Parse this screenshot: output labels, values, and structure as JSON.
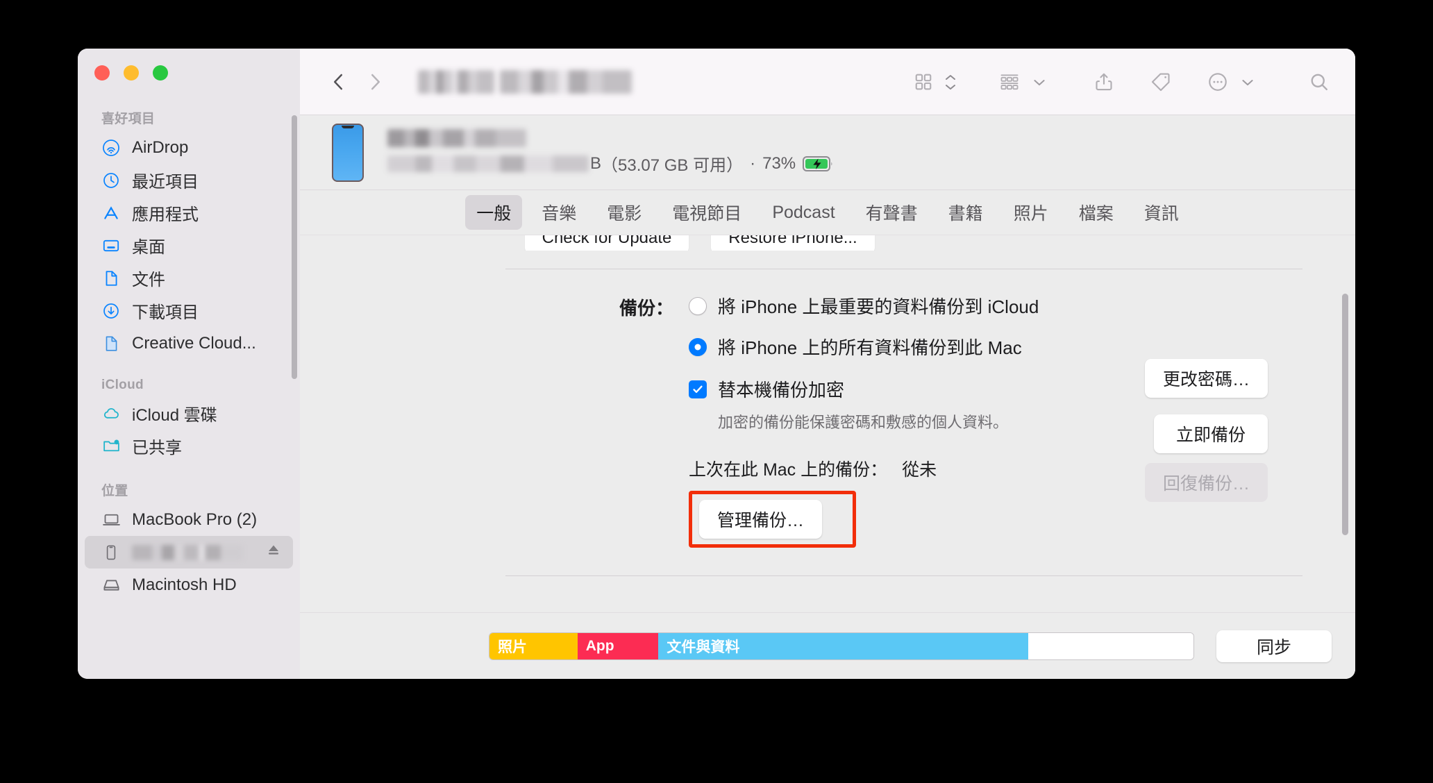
{
  "window": {
    "traffic_lights": [
      "close",
      "minimize",
      "zoom"
    ],
    "title_redacted": true
  },
  "toolbar": {
    "back_label": "‹",
    "forward_label": "›",
    "icons": [
      "grid-view-icon",
      "view-sort-chevrons-icon",
      "group-by-icon",
      "chevron-down-icon",
      "share-icon",
      "tag-icon",
      "more-actions-icon",
      "search-icon"
    ]
  },
  "sidebar": {
    "groups": [
      {
        "title": "喜好項目",
        "items": [
          {
            "label": "AirDrop",
            "icon": "airdrop-icon",
            "selected": false
          },
          {
            "label": "最近項目",
            "icon": "clock-icon",
            "selected": false
          },
          {
            "label": "應用程式",
            "icon": "applications-icon",
            "selected": false
          },
          {
            "label": "桌面",
            "icon": "desktop-icon",
            "selected": false
          },
          {
            "label": "文件",
            "icon": "document-icon",
            "selected": false
          },
          {
            "label": "下載項目",
            "icon": "downloads-icon",
            "selected": false
          },
          {
            "label": "Creative Cloud...",
            "icon": "file-blue-icon",
            "selected": false
          }
        ]
      },
      {
        "title": "iCloud",
        "items": [
          {
            "label": "iCloud 雲碟",
            "icon": "cloud-icon",
            "selected": false
          },
          {
            "label": "已共享",
            "icon": "shared-folder-icon",
            "selected": false
          }
        ]
      },
      {
        "title": "位置",
        "items": [
          {
            "label": "MacBook Pro (2)",
            "icon": "laptop-icon",
            "selected": false
          },
          {
            "label": "",
            "icon": "iphone-icon",
            "selected": true,
            "redacted": true,
            "eject": true
          },
          {
            "label": "Macintosh HD",
            "icon": "harddisk-icon",
            "selected": false
          }
        ]
      }
    ]
  },
  "device": {
    "name_redacted": true,
    "storage_free": "（53.07 GB 可用）",
    "storage_capacity_suffix": "B",
    "separator": "·",
    "battery_percent": "73%",
    "battery_charging": true
  },
  "tabs": [
    {
      "label": "一般",
      "active": true
    },
    {
      "label": "音樂",
      "active": false
    },
    {
      "label": "電影",
      "active": false
    },
    {
      "label": "電視節目",
      "active": false
    },
    {
      "label": "Podcast",
      "active": false
    },
    {
      "label": "有聲書",
      "active": false
    },
    {
      "label": "書籍",
      "active": false
    },
    {
      "label": "照片",
      "active": false
    },
    {
      "label": "檔案",
      "active": false
    },
    {
      "label": "資訊",
      "active": false
    }
  ],
  "content": {
    "clipped_buttons": [
      {
        "label": "Check for Update"
      },
      {
        "label": "Restore iPhone..."
      }
    ],
    "backup_section": {
      "label": "備份：",
      "options": [
        {
          "label": "將 iPhone 上最重要的資料備份到 iCloud",
          "checked": false
        },
        {
          "label": "將 iPhone 上的所有資料備份到此 Mac",
          "checked": true
        }
      ],
      "encrypt_checkbox": {
        "label": "替本機備份加密",
        "checked": true
      },
      "encrypt_hint": "加密的備份能保護密碼和敷感的個人資料。",
      "last_backup_label": "上次在此 Mac 上的備份：",
      "last_backup_value": "從未",
      "manage_backups_button": "管理備份…",
      "manage_backups_highlighted": true,
      "change_password_button": "更改密碼…",
      "backup_now_button": "立即備份",
      "restore_backup_button": "回復備份…",
      "restore_backup_disabled": true
    }
  },
  "bottom": {
    "capacity_segments": [
      {
        "label": "照片",
        "color": "#ffc500",
        "percent": 12.5
      },
      {
        "label": "App",
        "color": "#fc2c53",
        "percent": 11.5
      },
      {
        "label": "文件與資料",
        "color": "#5ac8f5",
        "percent": 52.5
      },
      {
        "label": "",
        "color": "#ffffff",
        "percent": 23.5
      }
    ],
    "sync_button": "同步"
  },
  "colors": {
    "accent_blue": "#007aff",
    "highlight_red": "#f22e0a",
    "photos_yellow": "#ffc500",
    "app_pink": "#fc2c53",
    "docs_blue": "#5ac8f5",
    "battery_green": "#34c759"
  }
}
